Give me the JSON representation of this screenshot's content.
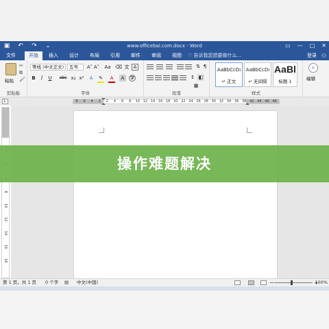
{
  "window": {
    "title": "www.officebai.com.docx - Word",
    "qat": {
      "save_icon": "save-icon",
      "undo_icon": "undo-icon",
      "redo_icon": "redo-icon"
    },
    "controls": [
      "▭",
      "—",
      "□",
      "✕"
    ]
  },
  "tabs": [
    {
      "label": "文件"
    },
    {
      "label": "开始"
    },
    {
      "label": "插入"
    },
    {
      "label": "设计"
    },
    {
      "label": "布局"
    },
    {
      "label": "引用"
    },
    {
      "label": "邮件"
    },
    {
      "label": "审阅"
    },
    {
      "label": "视图"
    }
  ],
  "tell_me": "♡ 告诉我您想要做什么...",
  "login": "登录",
  "ribbon": {
    "clipboard": {
      "paste": "粘贴",
      "group": "剪贴板"
    },
    "font": {
      "font_name": "等线 (中文正文)",
      "font_size": "五号",
      "group": "字体",
      "bold": "B",
      "italic": "I",
      "underline": "U",
      "strike": "abc",
      "sub": "x₂",
      "sup": "x²",
      "grow": "A˄",
      "shrink": "A˅",
      "case": "Aa",
      "color": "A"
    },
    "paragraph": {
      "group": "段落"
    },
    "styles": {
      "group": "样式",
      "items": [
        {
          "sample": "AaBbCcDı",
          "name": "↵ 正文"
        },
        {
          "sample": "AaBbCcDı",
          "name": "↵ 无间隔"
        },
        {
          "sample": "AaBl",
          "name": "标题 1"
        }
      ]
    },
    "editing": {
      "label": "编辑"
    }
  },
  "ruler": {
    "tab_selector": "L",
    "h_ticks": [
      "8",
      "6",
      "4",
      "2",
      "2",
      "4",
      "6",
      "8",
      "10",
      "12",
      "14",
      "16",
      "18",
      "20",
      "22",
      "24",
      "26",
      "28",
      "30",
      "32",
      "34",
      "36",
      "38",
      "42",
      "44",
      "46",
      "48"
    ],
    "v_ticks": [
      "2",
      "4",
      "6",
      "8",
      "10",
      "12",
      "14",
      "16",
      "18"
    ]
  },
  "status": {
    "page": "第 1 页，共 1 页",
    "words": "0 个字",
    "language": "中文(中国)",
    "zoom_minus": "−",
    "zoom_plus": "+",
    "zoom": "100%"
  },
  "banner": {
    "text": "操作难题解决"
  },
  "colors": {
    "word_blue": "#2b579a",
    "banner_green": "#6db24a"
  }
}
